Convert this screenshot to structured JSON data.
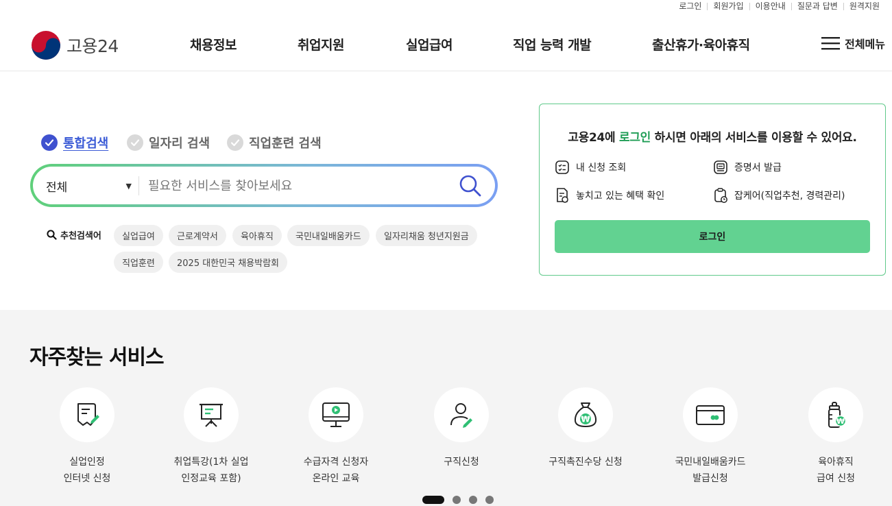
{
  "util_links": [
    "로그인",
    "회원가입",
    "이용안내",
    "질문과 답변",
    "원격지원"
  ],
  "header": {
    "logo_text": "고용24",
    "nav": [
      "채용정보",
      "취업지원",
      "실업급여",
      "직업 능력 개발",
      "출산휴가·육아휴직"
    ],
    "all_menu": "전체메뉴"
  },
  "search": {
    "tabs": [
      {
        "label": "통합검색",
        "active": true
      },
      {
        "label": "일자리 검색",
        "active": false
      },
      {
        "label": "직업훈련 검색",
        "active": false
      }
    ],
    "category": "전체",
    "placeholder": "필요한 서비스를 찾아보세요",
    "rec_label": "추천검색어",
    "keywords": [
      "실업급여",
      "근로계약서",
      "육아휴직",
      "국민내일배움카드",
      "일자리채움 청년지원금",
      "직업훈련",
      "2025 대한민국 채용박람회"
    ]
  },
  "login_box": {
    "title_pre": "고용24에 ",
    "title_highlight": "로그인",
    "title_post": " 하시면 아래의 서비스를 이용할 수 있어요.",
    "services": [
      "내 신청 조회",
      "증명서 발급",
      "놓치고 있는 혜택 확인",
      "잡케어(직업추천, 경력관리)"
    ],
    "button": "로그인"
  },
  "frequent": {
    "title": "자주찾는 서비스",
    "items": [
      {
        "label": "실업인정\n인터넷 신청",
        "icon": "document-pen-icon"
      },
      {
        "label": "취업특강(1차 실업\n인정교육 포함)",
        "icon": "presentation-board-icon"
      },
      {
        "label": "수급자격 신청자\n온라인 교육",
        "icon": "monitor-play-icon"
      },
      {
        "label": "구직신청",
        "icon": "person-pen-icon"
      },
      {
        "label": "구직촉진수당 신청",
        "icon": "money-bag-icon"
      },
      {
        "label": "국민내일배움카드\n발급신청",
        "icon": "card-icon"
      },
      {
        "label": "육아휴직\n급여 신청",
        "icon": "baby-bottle-icon"
      }
    ],
    "pagination_active": 1,
    "pagination_count": 4
  },
  "colors": {
    "accent_blue": "#3f51cf",
    "accent_green": "#1f9d55",
    "button_green": "#62d291",
    "icon_green": "#2fbf74"
  }
}
